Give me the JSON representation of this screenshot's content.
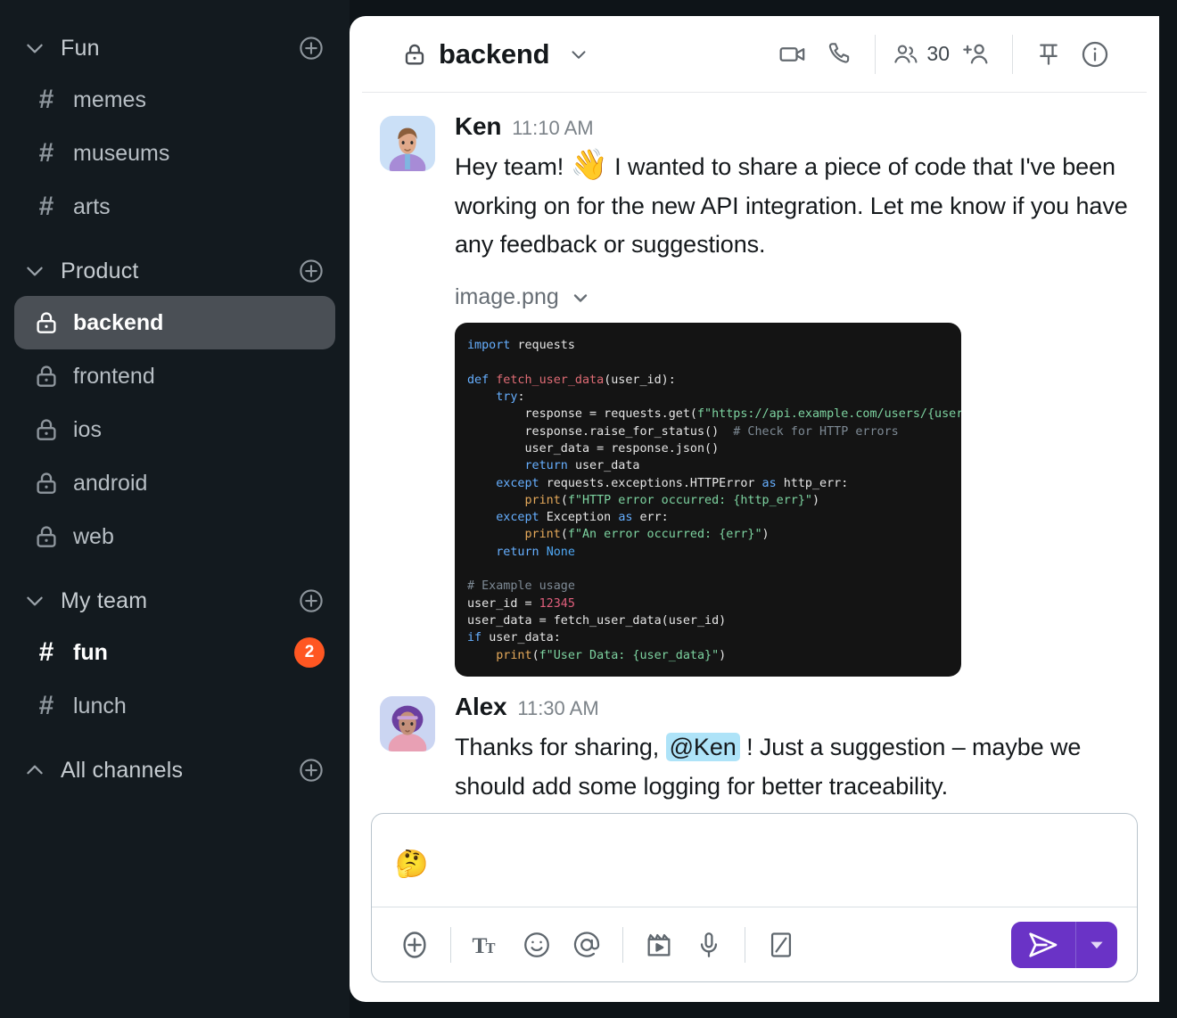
{
  "sidebar": {
    "groups": [
      {
        "name": "Fun",
        "icon": "chevron-down-icon",
        "add_icon": "plus-circle-icon",
        "channels": [
          {
            "name": "memes",
            "icon": "hash-icon",
            "state": "normal",
            "badge": ""
          },
          {
            "name": "museums",
            "icon": "hash-icon",
            "state": "normal",
            "badge": ""
          },
          {
            "name": "arts",
            "icon": "hash-icon",
            "state": "normal",
            "badge": ""
          }
        ]
      },
      {
        "name": "Product",
        "icon": "chevron-down-icon",
        "add_icon": "plus-circle-icon",
        "channels": [
          {
            "name": "backend",
            "icon": "lock-icon",
            "state": "active",
            "badge": ""
          },
          {
            "name": "frontend",
            "icon": "lock-icon",
            "state": "normal",
            "badge": ""
          },
          {
            "name": "ios",
            "icon": "lock-icon",
            "state": "normal",
            "badge": ""
          },
          {
            "name": "android",
            "icon": "lock-icon",
            "state": "normal",
            "badge": ""
          },
          {
            "name": "web",
            "icon": "lock-icon",
            "state": "normal",
            "badge": ""
          }
        ]
      },
      {
        "name": "My team",
        "icon": "chevron-down-icon",
        "add_icon": "plus-circle-icon",
        "channels": [
          {
            "name": "fun",
            "icon": "hash-icon",
            "state": "unread",
            "badge": "2"
          },
          {
            "name": "lunch",
            "icon": "hash-icon",
            "state": "normal",
            "badge": ""
          }
        ]
      },
      {
        "name": "All channels",
        "icon": "chevron-up-icon",
        "add_icon": "plus-circle-icon",
        "channels": []
      }
    ],
    "badge_color": "#FF5722",
    "active_bg": "#4A4F55"
  },
  "header": {
    "lock_icon": "lock-icon",
    "channel_name": "backend",
    "caret_icon": "chevron-down-icon",
    "video_icon": "video-camera-icon",
    "call_icon": "phone-icon",
    "members_icon": "people-icon",
    "members_count": "30",
    "add_member_icon": "add-person-icon",
    "pin_icon": "pin-icon",
    "info_icon": "info-circle-icon"
  },
  "messages": [
    {
      "author": "Ken",
      "time": "11:10 AM",
      "text_before": "Hey team! ",
      "emoji": "👋",
      "text_after": " I wanted to share a piece of code that I've been working on for the new API integration. Let me know if you have any feedback or suggestions.",
      "attachment": {
        "filename": "image.png",
        "caret_icon": "chevron-down-icon"
      }
    },
    {
      "author": "Alex",
      "time": "11:30 AM",
      "text_before": "Thanks for sharing, ",
      "mention": "@Ken",
      "text_after": " ! Just a suggestion – maybe we should add some logging for better traceability.",
      "mention_bg": "#AEE3F8"
    }
  ],
  "code_snippet": {
    "language": "python",
    "background": "#141414",
    "lines": [
      "import requests",
      "",
      "def fetch_user_data(user_id):",
      "    try:",
      "        response = requests.get(f\"https://api.example.com/users/{user_id}\")",
      "        response.raise_for_status()  # Check for HTTP errors",
      "        user_data = response.json()",
      "        return user_data",
      "    except requests.exceptions.HTTPError as http_err:",
      "        print(f\"HTTP error occurred: {http_err}\")",
      "    except Exception as err:",
      "        print(f\"An error occurred: {err}\")",
      "    return None",
      "",
      "# Example usage",
      "user_id = 12345",
      "user_data = fetch_user_data(user_id)",
      "if user_data:",
      "    print(f\"User Data: {user_data}\")"
    ]
  },
  "composer": {
    "value": "🤔",
    "placeholder": "",
    "tools": [
      {
        "name": "attach-plus-icon",
        "label": "Add"
      },
      {
        "name": "text-format-icon",
        "label": "Tt"
      },
      {
        "name": "emoji-icon",
        "label": "Emoji"
      },
      {
        "name": "mention-icon",
        "label": "@"
      },
      {
        "name": "video-clip-icon",
        "label": "Clip"
      },
      {
        "name": "microphone-icon",
        "label": "Voice"
      },
      {
        "name": "whiteboard-icon",
        "label": "Draw"
      }
    ],
    "send_icon": "send-icon",
    "send_dropdown_icon": "chevron-down-icon",
    "send_color": "#6A33C6"
  }
}
